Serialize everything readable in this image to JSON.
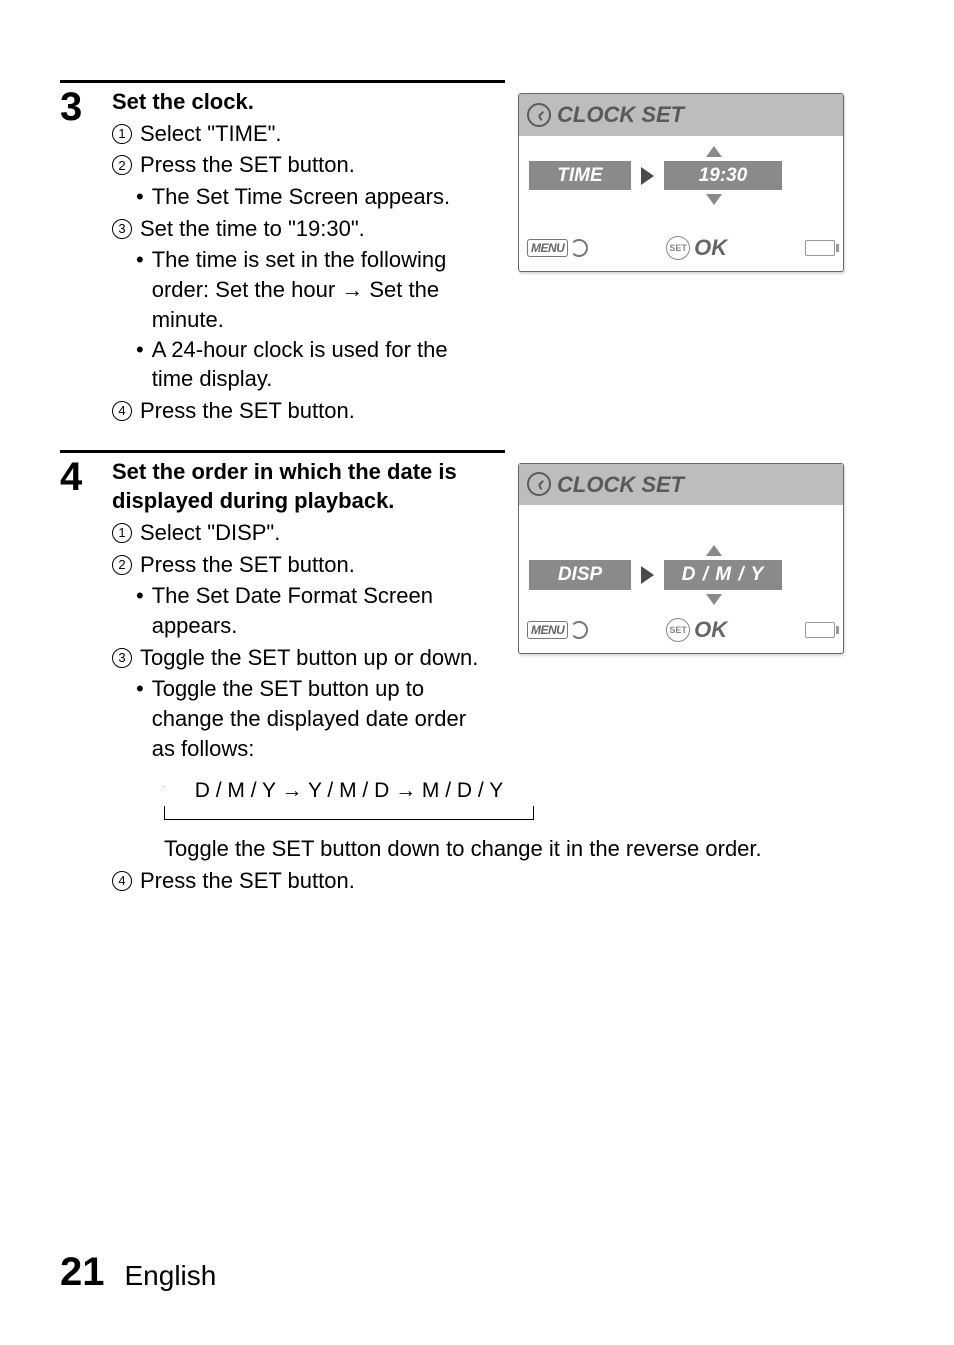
{
  "step3": {
    "number": "3",
    "title": "Set the clock.",
    "sub1": "Select \"TIME\".",
    "sub2": "Press the SET button.",
    "sub2_b1": "The Set Time Screen appears.",
    "sub3": "Set the time to \"19:30\".",
    "sub3_b1": "The time is set in the following order: Set the hour → Set the minute.",
    "sub3_b2": "A 24-hour clock is used for the time display.",
    "sub4": "Press the SET button."
  },
  "step4": {
    "number": "4",
    "title": "Set the order in which the date is displayed during playback.",
    "sub1": "Select \"DISP\".",
    "sub2": "Press the SET button.",
    "sub2_b1": "The Set Date Format Screen appears.",
    "sub3": "Toggle the SET button up or down.",
    "sub3_b1": "Toggle the SET button up to change the displayed date order as follows:",
    "cycle": "D / M / Y → Y / M / D → M / D / Y",
    "after_cycle": "Toggle the SET button down to change it in the reverse order.",
    "sub4": "Press the SET button."
  },
  "screen1": {
    "title": "CLOCK SET",
    "label": "TIME",
    "value": "19:30",
    "menu": "MENU",
    "set": "SET",
    "ok": "OK"
  },
  "screen2": {
    "title": "CLOCK SET",
    "label": "DISP",
    "value": "D / M / Y",
    "menu": "MENU",
    "set": "SET",
    "ok": "OK"
  },
  "footer": {
    "page": "21",
    "lang": "English"
  },
  "enum": {
    "n1": "1",
    "n2": "2",
    "n3": "3",
    "n4": "4"
  }
}
